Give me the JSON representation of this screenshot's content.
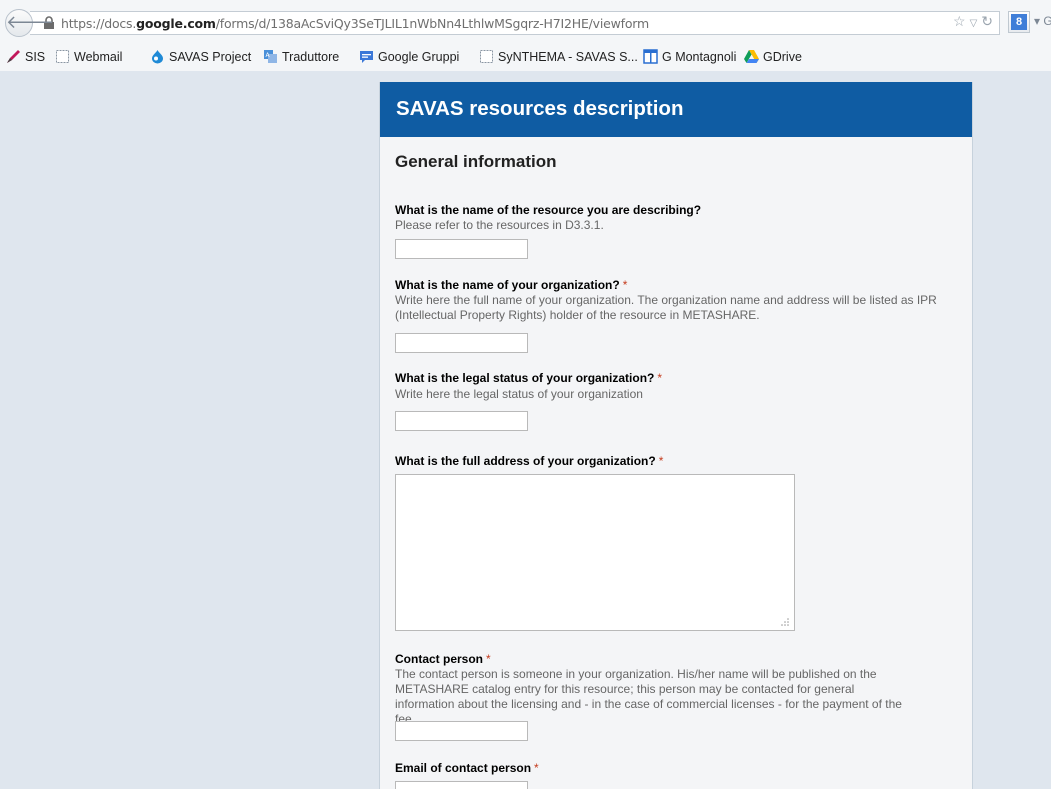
{
  "browser": {
    "url_prefix": "https://docs.",
    "url_domain": "google.com",
    "url_path": "/forms/d/138aAcSviQy3SeTJLIL1nWbNn4LthlwMSgqrz-H7I2HE/viewform",
    "gplus_label": "8",
    "gplus_trailing": "▾ G"
  },
  "bookmarks": [
    {
      "label": "SIS",
      "icon": "pen-icon"
    },
    {
      "label": "Webmail",
      "icon": "blank-page-icon"
    },
    {
      "label": "SAVAS Project",
      "icon": "drupal-drop-icon"
    },
    {
      "label": "Traduttore",
      "icon": "translate-icon"
    },
    {
      "label": "Google Gruppi",
      "icon": "groups-icon"
    },
    {
      "label": "SyNTHEMA - SAVAS S...",
      "icon": "blank-page-icon"
    },
    {
      "label": "G Montagnoli",
      "icon": "sites-icon"
    },
    {
      "label": "GDrive",
      "icon": "drive-icon"
    }
  ],
  "form": {
    "title": "SAVAS resources description",
    "section_title": "General information",
    "required_mark": "*",
    "questions": [
      {
        "title": "What is the name of the resource you are describing?",
        "help": "Please refer to the resources in D3.3.1.",
        "required": false,
        "value": ""
      },
      {
        "title": "What is the name of your organization?",
        "help": "Write here the full name of your organization. The organization name and address will be listed as IPR (Intellectual Property Rights) holder of the resource in METASHARE.",
        "required": true,
        "value": ""
      },
      {
        "title": "What is the legal status of your organization?",
        "help": "Write here the legal status of your organization",
        "required": true,
        "value": ""
      },
      {
        "title": "What is the full address of your organization?",
        "help": "",
        "required": true,
        "value": ""
      },
      {
        "title": "Contact person",
        "help": "The contact person is someone in your organization. His/her name will be published on the METASHARE catalog entry for this resource; this person may be contacted for general information about the licensing and - in the case of commercial licenses - for the payment of the fee.",
        "required": true,
        "value": ""
      },
      {
        "title": "Email of contact person",
        "help": "",
        "required": true,
        "value": ""
      }
    ]
  },
  "colors": {
    "header_blue": "#0f5ca3",
    "required_red": "#c43b1d",
    "page_bg": "#dfe6ee"
  }
}
